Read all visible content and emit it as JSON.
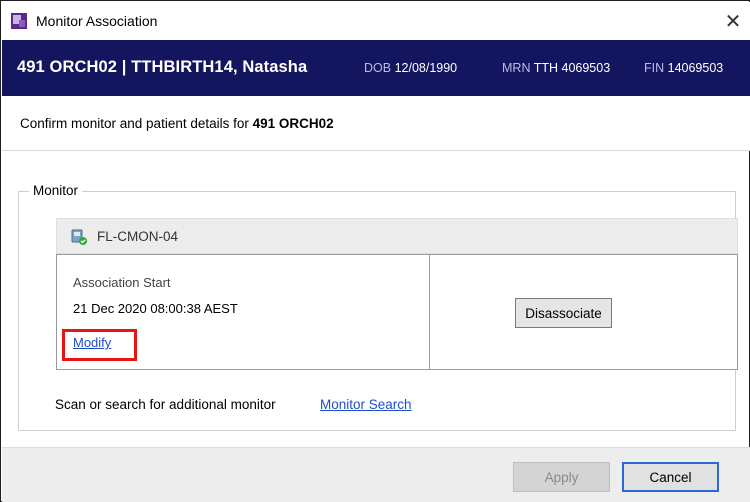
{
  "window": {
    "title": "Monitor Association",
    "close_glyph": "✕",
    "icon": "app-icon"
  },
  "banner": {
    "location_patient": "491 ORCH02 | TTHBIRTH14, Natasha",
    "dob_label": "DOB",
    "dob_value": "12/08/1990",
    "mrn_label": "MRN",
    "mrn_value": "TTH 4069503",
    "fin_label": "FIN",
    "fin_value": "14069503",
    "background_color": "#14155f"
  },
  "confirm": {
    "prefix": "Confirm monitor and patient details for ",
    "location": "491 ORCH02"
  },
  "monitor_group": {
    "legend": "Monitor",
    "monitor_name": "FL-CMON-04",
    "monitor_icon": "monitor-device-icon",
    "association_start_label": "Association Start",
    "association_start_value": "21 Dec 2020 08:00:38 AEST",
    "modify_label": "Modify",
    "disassociate_label": "Disassociate",
    "scan_text": "Scan or search for additional monitor",
    "monitor_search_label": "Monitor Search",
    "highlight_color": "#e81313",
    "link_color": "#1f4fc8"
  },
  "footer": {
    "apply_label": "Apply",
    "apply_enabled": false,
    "cancel_label": "Cancel"
  }
}
